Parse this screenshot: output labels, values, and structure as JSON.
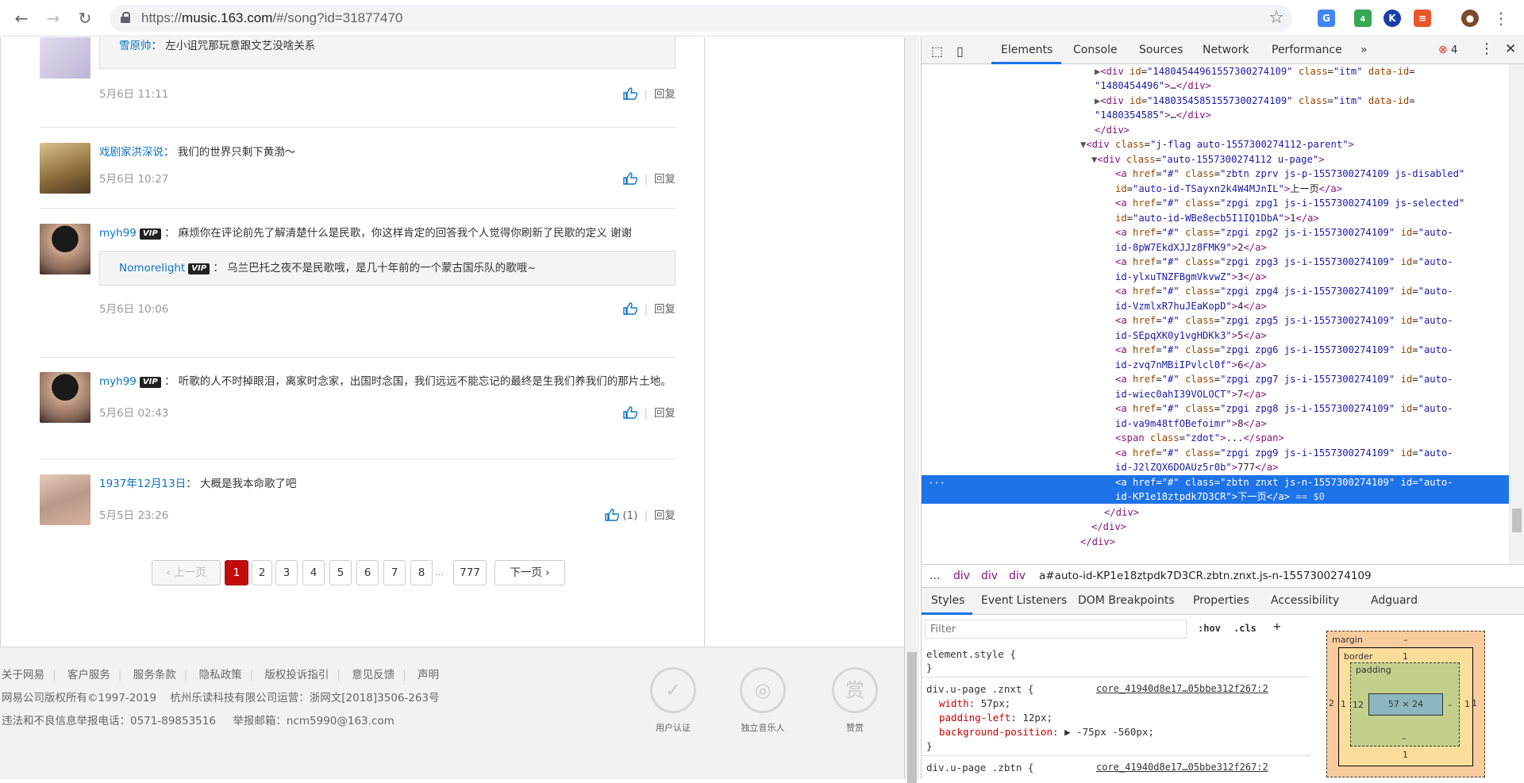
{
  "browser": {
    "url_prefix": "https://",
    "url_host": "music.163.com",
    "url_path": "/#/song?id=31877470",
    "ext_badge": "4"
  },
  "comments": [
    {
      "quote_user": "雪原帅",
      "quote_text": "：  左小诅咒那玩意跟文艺没啥关系",
      "time": "5月6日 11:11",
      "reply": "回复"
    },
    {
      "user": "戏剧家洪深说",
      "text": "：  我们的世界只剩下黄渤～",
      "time": "5月6日 10:27",
      "reply": "回复"
    },
    {
      "user": "myh99",
      "vip": "VIP",
      "text": "：  麻烦你在评论前先了解清楚什么是民歌，你这样肯定的回答我个人觉得你刷新了民歌的定义 谢谢",
      "quote_user": "Nomorelight",
      "quote_vip": "VIP",
      "quote_text": "：  乌兰巴托之夜不是民歌哦，是几十年前的一个蒙古国乐队的歌哦~",
      "time": "5月6日 10:06",
      "reply": "回复"
    },
    {
      "user": "myh99",
      "vip": "VIP",
      "text": "：  听歌的人不时掉眼泪，离家时念家，出国时念国，我们远远不能忘记的最终是生我们养我们的那片土地。",
      "time": "5月6日 02:43",
      "reply": "回复"
    },
    {
      "user": "1937年12月13日",
      "text": "：  大概是我本命歌了吧",
      "time": "5月5日 23:26",
      "likes": "(1)",
      "reply": "回复"
    }
  ],
  "pager": {
    "prev": "‹ 上一页",
    "pages": [
      "1",
      "2",
      "3",
      "4",
      "5",
      "6",
      "7",
      "8"
    ],
    "ellipsis": "...",
    "last": "777",
    "next": "下一页 ›"
  },
  "footer": {
    "links": [
      "关于网易",
      "客户服务",
      "服务条款",
      "隐私政策",
      "版权投诉指引",
      "意见反馈",
      "声明"
    ],
    "copyright": "网易公司版权所有©1997-2019    杭州乐读科技有限公司运营：浙网文[2018]3506-263号",
    "report": "违法和不良信息举报电话：0571-89853516     举报邮箱：ncm5990@163.com",
    "badges": [
      "用户认证",
      "独立音乐人",
      "赞赏"
    ],
    "badge_glyph_3": "赏"
  },
  "devtools": {
    "tabs": [
      "Elements",
      "Console",
      "Sources",
      "Network",
      "Performance",
      "»"
    ],
    "error_count": "4",
    "crumbs": [
      "...",
      "div",
      "div",
      "div",
      "a#auto-id-KP1e18ztpdk7D3CR.zbtn.znxt.js-n-1557300274109"
    ],
    "subtabs": [
      "Styles",
      "Event Listeners",
      "DOM Breakpoints",
      "Properties",
      "Accessibility",
      "Adguard"
    ],
    "filter_placeholder": "Filter",
    "hov": ":hov",
    "cls": ".cls",
    "plus": "+",
    "element_style": "element.style {",
    "close_brace": "}",
    "rule1_selector": "div.u-page .znxt {",
    "rule1_source": "core_41940d8e17…05bbe312f267:2",
    "rule1_props": [
      {
        "name": "width",
        "value": "57px;"
      },
      {
        "name": "padding-left",
        "value": "12px;"
      },
      {
        "name": "background-position",
        "value": "▶ -75px -560px;"
      }
    ],
    "rule2_selector": "div.u-page .zbtn {",
    "rule2_source": "core_41940d8e17…05bbe312f267:2",
    "box": {
      "margin": "margin",
      "border": "border",
      "padding": "padding",
      "content": "57 × 24",
      "dash": "–",
      "one": "1",
      "two": "2",
      "twelve": "12"
    },
    "selected_suffix": " == $0"
  }
}
